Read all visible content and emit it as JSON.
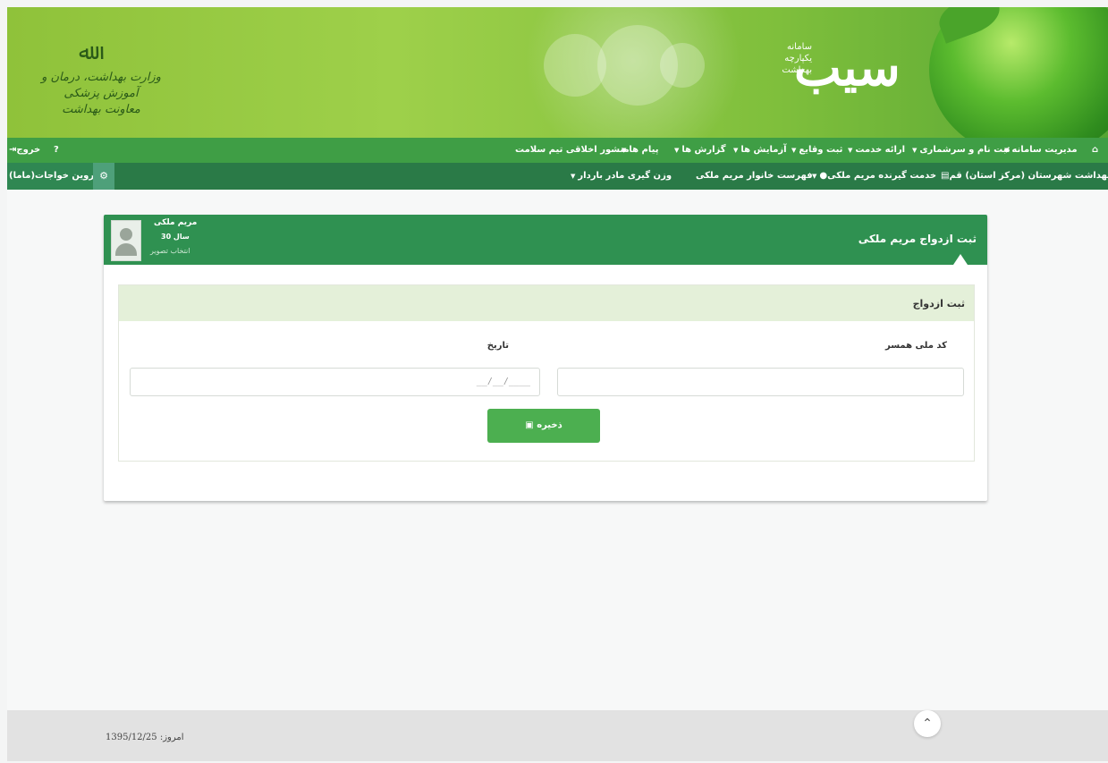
{
  "banner": {
    "brand": "سیب",
    "brand_sub_1": "سامانه",
    "brand_sub_2": "یکپارچه",
    "brand_sub_3": "بهداشت",
    "emblem": "ﷲ",
    "ministry_line_1": "وزارت بهداشت، درمان و آموزش پزشکی",
    "ministry_line_2": "معاونت بهداشت"
  },
  "nav1": {
    "home_icon": "home-icon",
    "items": [
      "مدیریت سامانه",
      "ثبت نام و سرشماری",
      "ارائه خدمت",
      "ثبت وقایع",
      "آزمایش ها",
      "گزارش ها",
      "پیام ها",
      "منشور اخلاقی تیم سلامت"
    ],
    "help_icon": "?",
    "logout_label": "خروج"
  },
  "nav2": {
    "center": "مرکز بهداشت شهرستان (مرکز استان) قم",
    "service_receiver": "خدمت گیرنده مریم ملکی",
    "family_list": "فهرست خانوار مریم ملکی",
    "weighing": "وزن گیری مادر باردار",
    "user": "پروین خواجات(ماما)"
  },
  "panel": {
    "title": "ثبت ازدواج مریم ملکی",
    "patient_name": "مریم ملکی",
    "patient_age": "30 سال",
    "select_photo": "انتخاب تصویر",
    "section_title": "ثبت ازدواج",
    "spouse_label": "کد ملی همسر",
    "spouse_value": "",
    "date_label": "تاریخ",
    "date_placeholder": "__/__/____",
    "save_label": "ذخیره"
  },
  "footer": {
    "today": "امروز: 1395/12/25"
  },
  "colors": {
    "nav1": "#3f9e45",
    "nav2": "#2a7a47",
    "panel_head": "#2f9151",
    "save": "#4caf50"
  }
}
